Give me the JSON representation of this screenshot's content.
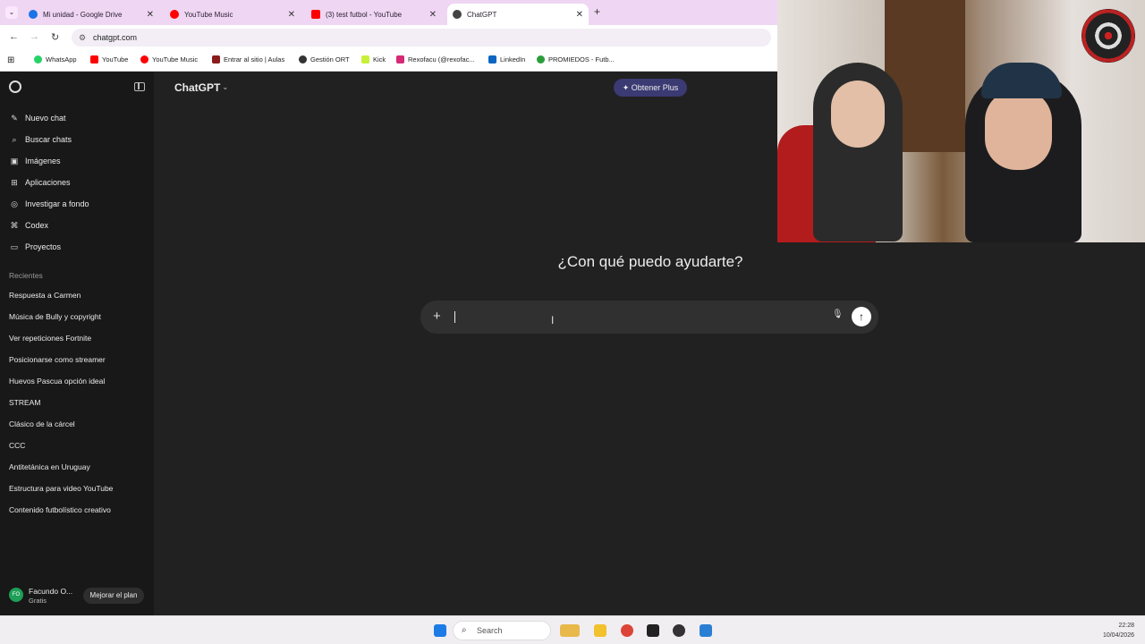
{
  "browser": {
    "tabs": [
      {
        "title": "Mi unidad - Google Drive",
        "color": "#1a73e8"
      },
      {
        "title": "YouTube Music",
        "color": "#ff0000"
      },
      {
        "title": "(3) test futbol - YouTube",
        "color": "#ff0000"
      },
      {
        "title": "ChatGPT",
        "color": "#444444"
      }
    ],
    "url": "chatgpt.com",
    "bookmarks": [
      "WhatsApp",
      "YouTube",
      "YouTube Music",
      "Entrar al sitio | Aulas",
      "Gestión ORT",
      "Kick",
      "Rexofacu (@rexofac...",
      "LinkedIn",
      "PROMIEDOS - Futb..."
    ]
  },
  "sidebar": {
    "items": [
      {
        "label": "Nuevo chat",
        "icon": "✎"
      },
      {
        "label": "Buscar chats",
        "icon": "⌕"
      },
      {
        "label": "Imágenes",
        "icon": "▣"
      },
      {
        "label": "Aplicaciones",
        "icon": "⊞"
      },
      {
        "label": "Investigar a fondo",
        "icon": "◎"
      },
      {
        "label": "Codex",
        "icon": "⌘"
      },
      {
        "label": "Proyectos",
        "icon": "▭"
      }
    ],
    "recents_title": "Recientes",
    "recents": [
      "Respuesta a Carmen",
      "Música de Bully y copyright",
      "Ver repeticiones Fortnite",
      "Posicionarse como streamer",
      "Huevos Pascua opción ideal",
      "STREAM",
      "Clásico de la cárcel",
      "CCC",
      "Antitetánica en Uruguay",
      "Estructura para video YouTube",
      "Contenido futbolístico creativo"
    ],
    "user": {
      "initials": "FO",
      "name": "Facundo O...",
      "plan": "Gratis",
      "upgrade": "Mejorar el plan"
    }
  },
  "main": {
    "title": "ChatGPT",
    "plus_button": "Obtener Plus",
    "heading": "¿Con qué puedo ayudarte?",
    "composer_value": ""
  },
  "taskbar": {
    "search": "Search",
    "time": "22:28",
    "date": "10/04/2026"
  }
}
